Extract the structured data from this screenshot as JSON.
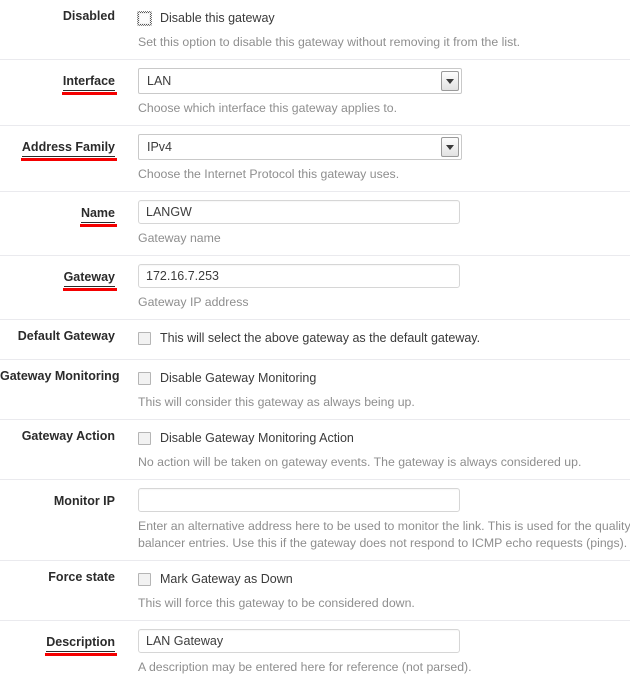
{
  "form": {
    "rows": [
      {
        "label": "Disabled",
        "label_marked": false,
        "type": "checkbox",
        "checkbox_label": "Disable this gateway",
        "focused": true,
        "help": "Set this option to disable this gateway without removing it from the list."
      },
      {
        "label": "Interface",
        "label_marked": true,
        "type": "select",
        "value": "LAN",
        "help": "Choose which interface this gateway applies to."
      },
      {
        "label": "Address Family",
        "label_marked": true,
        "type": "select",
        "value": "IPv4",
        "help": "Choose the Internet Protocol this gateway uses."
      },
      {
        "label": "Name",
        "label_marked": true,
        "type": "text",
        "value": "LANGW",
        "placeholder": "",
        "help": "Gateway name"
      },
      {
        "label": "Gateway",
        "label_marked": true,
        "type": "text",
        "value": "172.16.7.253",
        "placeholder": "",
        "help": "Gateway IP address"
      },
      {
        "label": "Default Gateway",
        "label_marked": false,
        "type": "checkbox",
        "checkbox_label": "This will select the above gateway as the default gateway.",
        "focused": false,
        "help": ""
      },
      {
        "label": "Gateway Monitoring",
        "label_marked": false,
        "type": "checkbox",
        "checkbox_label": "Disable Gateway Monitoring",
        "focused": false,
        "help": "This will consider this gateway as always being up."
      },
      {
        "label": "Gateway Action",
        "label_marked": false,
        "type": "checkbox",
        "checkbox_label": "Disable Gateway Monitoring Action",
        "focused": false,
        "help": "No action will be taken on gateway events. The gateway is always considered up."
      },
      {
        "label": "Monitor IP",
        "label_marked": false,
        "type": "text",
        "value": "",
        "placeholder": "",
        "help": "Enter an alternative address here to be used to monitor the link. This is used for the quality load balancer entries. Use this if the gateway does not respond to ICMP echo requests (pings)."
      },
      {
        "label": "Force state",
        "label_marked": false,
        "type": "checkbox",
        "checkbox_label": "Mark Gateway as Down",
        "focused": false,
        "help": "This will force this gateway to be considered down."
      },
      {
        "label": "Description",
        "label_marked": true,
        "type": "text",
        "value": "LAN Gateway",
        "placeholder": "",
        "help": "A description may be entered here for reference (not parsed)."
      }
    ]
  },
  "colors": {
    "marker": "#f40000",
    "label": "#2b2b2b",
    "help": "#8e8e8e",
    "divider": "#eaeaee"
  },
  "icons": {
    "dropdown": "chevron-down-icon",
    "checkbox": "checkbox-icon"
  }
}
